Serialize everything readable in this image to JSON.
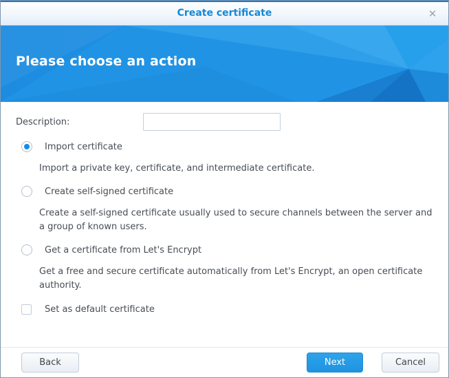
{
  "dialog": {
    "title": "Create certificate",
    "close_icon": "✕"
  },
  "header": {
    "heading": "Please choose an action"
  },
  "form": {
    "description_label": "Description:",
    "description_value": "",
    "options": [
      {
        "label": "Import certificate",
        "description": "Import a private key, certificate, and intermediate certificate.",
        "selected": true
      },
      {
        "label": "Create self-signed certificate",
        "description": "Create a self-signed certificate usually used to secure channels between the server and a group of known users.",
        "selected": false
      },
      {
        "label": "Get a certificate from Let's Encrypt",
        "description": "Get a free and secure certificate automatically from Let's Encrypt, an open certificate authority.",
        "selected": false
      }
    ],
    "checkbox": {
      "label": "Set as default certificate",
      "checked": false
    }
  },
  "footer": {
    "back_label": "Back",
    "next_label": "Next",
    "cancel_label": "Cancel"
  },
  "colors": {
    "accent_blue": "#1588d6",
    "banner_blue": "#1d8ce0",
    "next_button_blue": "#2399e4",
    "text_gray": "#474d55"
  }
}
